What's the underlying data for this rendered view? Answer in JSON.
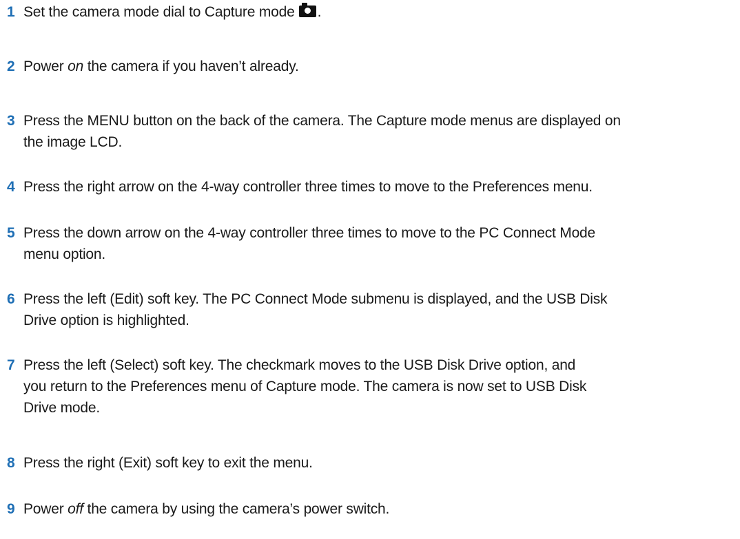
{
  "steps": [
    {
      "number": "1",
      "text_before": "Set the camera mode dial to Capture mode",
      "icon": "camera-icon",
      "text_after": "."
    },
    {
      "number": "2",
      "text_before": "Power ",
      "emphasis": "on",
      "text_after": " the camera if you haven’t already."
    },
    {
      "number": "3",
      "line1": "Press the MENU button on the back of the camera. The Capture mode menus are displayed on",
      "line2": "the image LCD."
    },
    {
      "number": "4",
      "line1": "Press the right arrow on the 4-way controller three times to move to the Preferences menu."
    },
    {
      "number": "5",
      "line1": "Press the down arrow on the 4-way controller three times to move to the PC Connect Mode",
      "line2": "menu option."
    },
    {
      "number": "6",
      "line1": "Press the left (Edit) soft key. The PC Connect Mode submenu is displayed, and the USB Disk",
      "line2": "Drive option is highlighted."
    },
    {
      "number": "7",
      "line1": "Press the left (Select) soft key. The checkmark moves to the USB Disk Drive option, and",
      "line2": "you return to the Preferences menu of Capture mode. The camera is now set to USB Disk",
      "line3": "Drive mode."
    },
    {
      "number": "8",
      "line1": "Press the right (Exit) soft key to exit the menu."
    },
    {
      "number": "9",
      "text_before": "Power ",
      "emphasis": "off",
      "text_after": " the camera by using the camera’s power switch."
    }
  ],
  "colors": {
    "step_number": "#1f6fb5",
    "body_text": "#1a1a1a",
    "background": "#ffffff"
  }
}
